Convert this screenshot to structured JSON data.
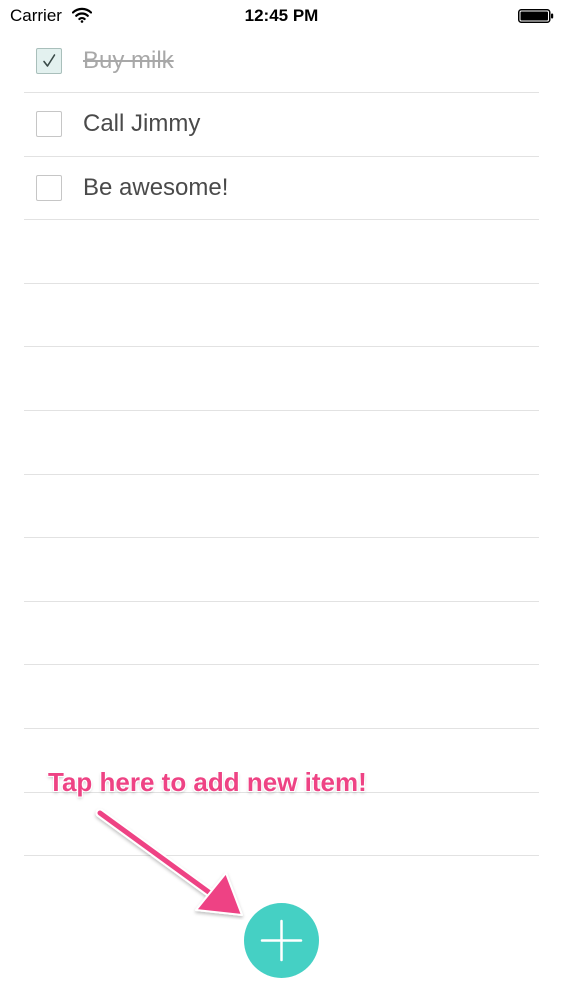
{
  "status_bar": {
    "carrier": "Carrier",
    "time": "12:45 PM",
    "wifi_icon": "wifi-icon",
    "battery_icon": "battery-icon"
  },
  "todo_list": {
    "items": [
      {
        "label": "Buy milk",
        "checked": true
      },
      {
        "label": "Call Jimmy",
        "checked": false
      },
      {
        "label": "Be awesome!",
        "checked": false
      }
    ],
    "empty_rows": 10
  },
  "hint": {
    "text": "Tap here to add new item!",
    "arrow_icon": "arrow-icon"
  },
  "add_button": {
    "icon": "plus-icon"
  },
  "colors": {
    "accent": "#45d0c4",
    "hint": "#ee4384",
    "divider": "#e2e2e2",
    "text": "#4a4a4a",
    "done_text": "#a8a8a8"
  }
}
